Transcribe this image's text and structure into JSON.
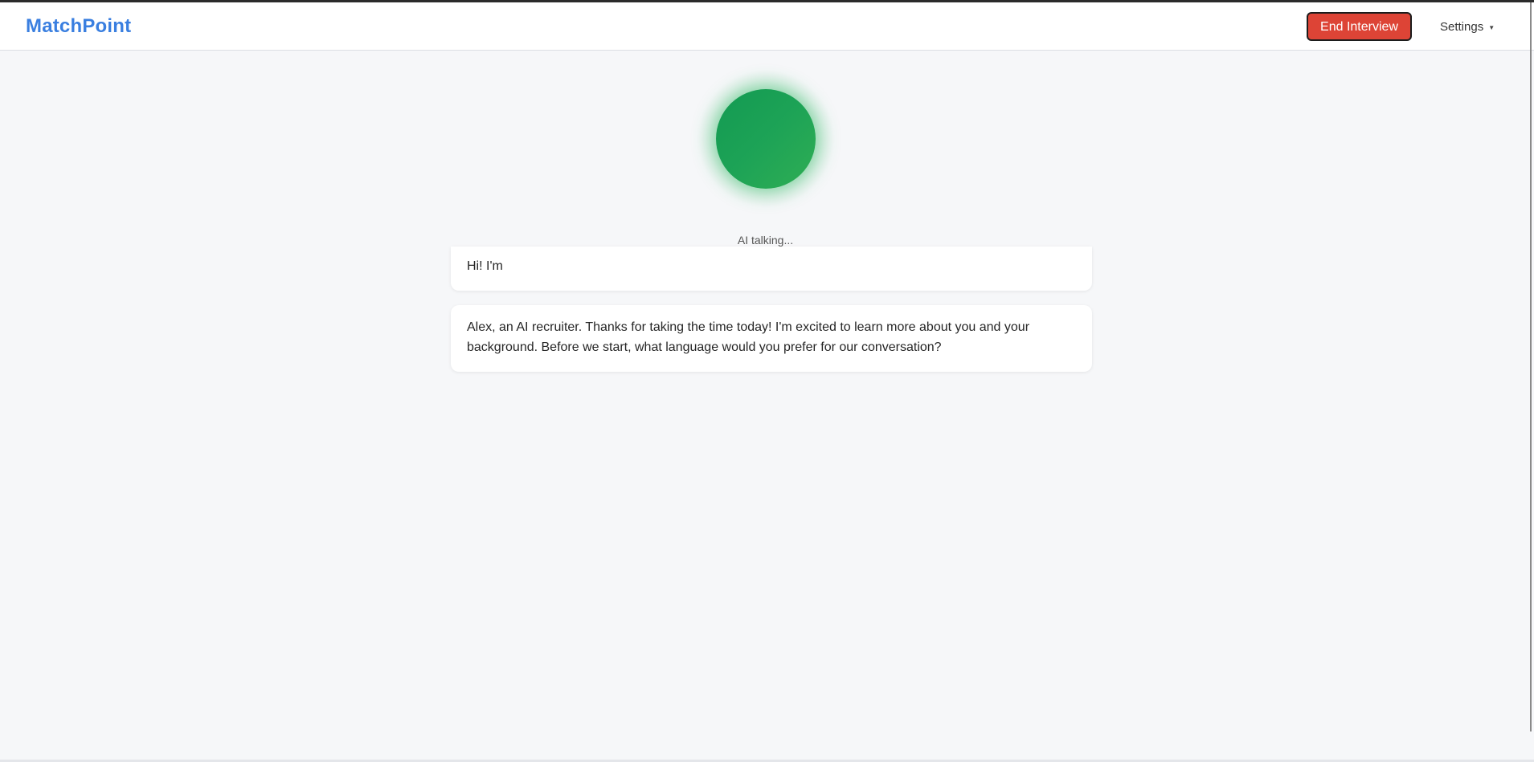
{
  "app": {
    "brand": "MatchPoint"
  },
  "header": {
    "end_button_label": "End Interview",
    "settings_label": "Settings",
    "settings_caret": "▼"
  },
  "agent": {
    "status": "AI talking...",
    "orb_color": "#1da356",
    "icon": "speaking-orb-icon"
  },
  "messages": [
    {
      "text": "Hi! I'm"
    },
    {
      "text": "Alex, an AI recruiter. Thanks for taking the time today! I'm excited to learn more about you and your background. Before we start, what language would you prefer for our conversation?"
    }
  ],
  "colors": {
    "brand": "#3a7fe0",
    "danger": "#dd4436",
    "background": "#f6f7f9"
  }
}
